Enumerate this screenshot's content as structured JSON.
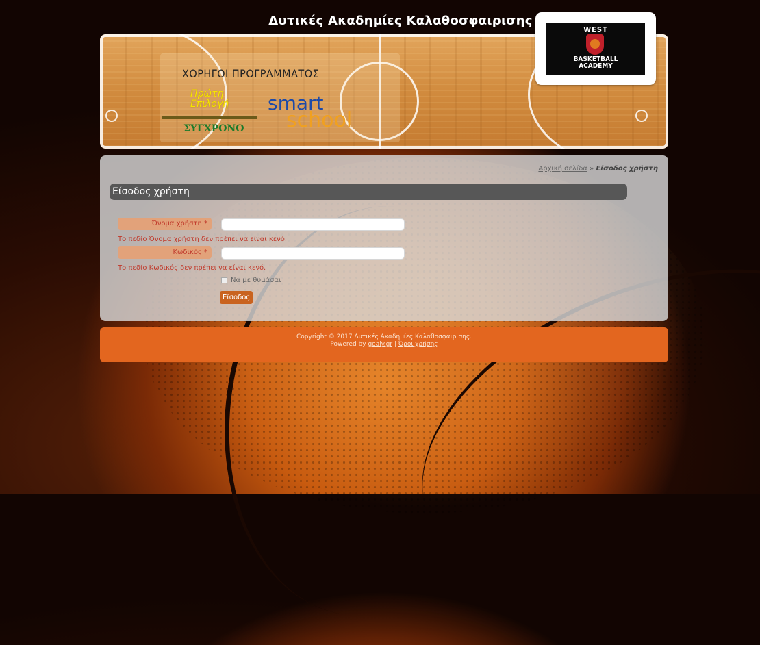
{
  "site": {
    "title": "Δυτικές Ακαδημίες Καλαθοσφαιρισης"
  },
  "banner": {
    "sponsors_heading": "ΧΟΡΗΓΟΙ ΠΡΟΓΡΑΜΜΑΤΟΣ",
    "sponsor1_line1": "Πρώτη",
    "sponsor1_line2": "Επιλογή",
    "sponsor1_name": "ΣΥΓΧΡΟΝΟ",
    "sponsor2_a": "smart",
    "sponsor2_b": "school"
  },
  "logo": {
    "top": "WEST",
    "line1": "BASKETBALL",
    "line2": "ACADEMY"
  },
  "breadcrumb": {
    "home": "Αρχική σελίδα",
    "separator": "»",
    "current": "Είσοδος χρήστη"
  },
  "form": {
    "heading": "Είσοδος χρήστη",
    "username_label": "Όνομα χρήστη *",
    "username_value": "",
    "username_error": "Το πεδίο Όνομα χρήστη δεν πρέπει να είναι κενό.",
    "password_label": "Κωδικός *",
    "password_value": "",
    "password_error": "Το πεδίο Κωδικός δεν πρέπει να είναι κενό.",
    "remember_label": "Να με θυμάσαι",
    "remember_checked": false,
    "submit_label": "Είσοδος"
  },
  "footer": {
    "copyright": "Copyright © 2017 Δυτικές Ακαδημίες Καλαθοσφαιρισης.",
    "powered_by": "Powered by",
    "powered_link": "goaly.gr",
    "divider": "|",
    "terms_link": "Όροι χρήσης"
  },
  "colors": {
    "accent": "#e3661f",
    "error": "#c0392b",
    "heading_bar": "#575757"
  }
}
